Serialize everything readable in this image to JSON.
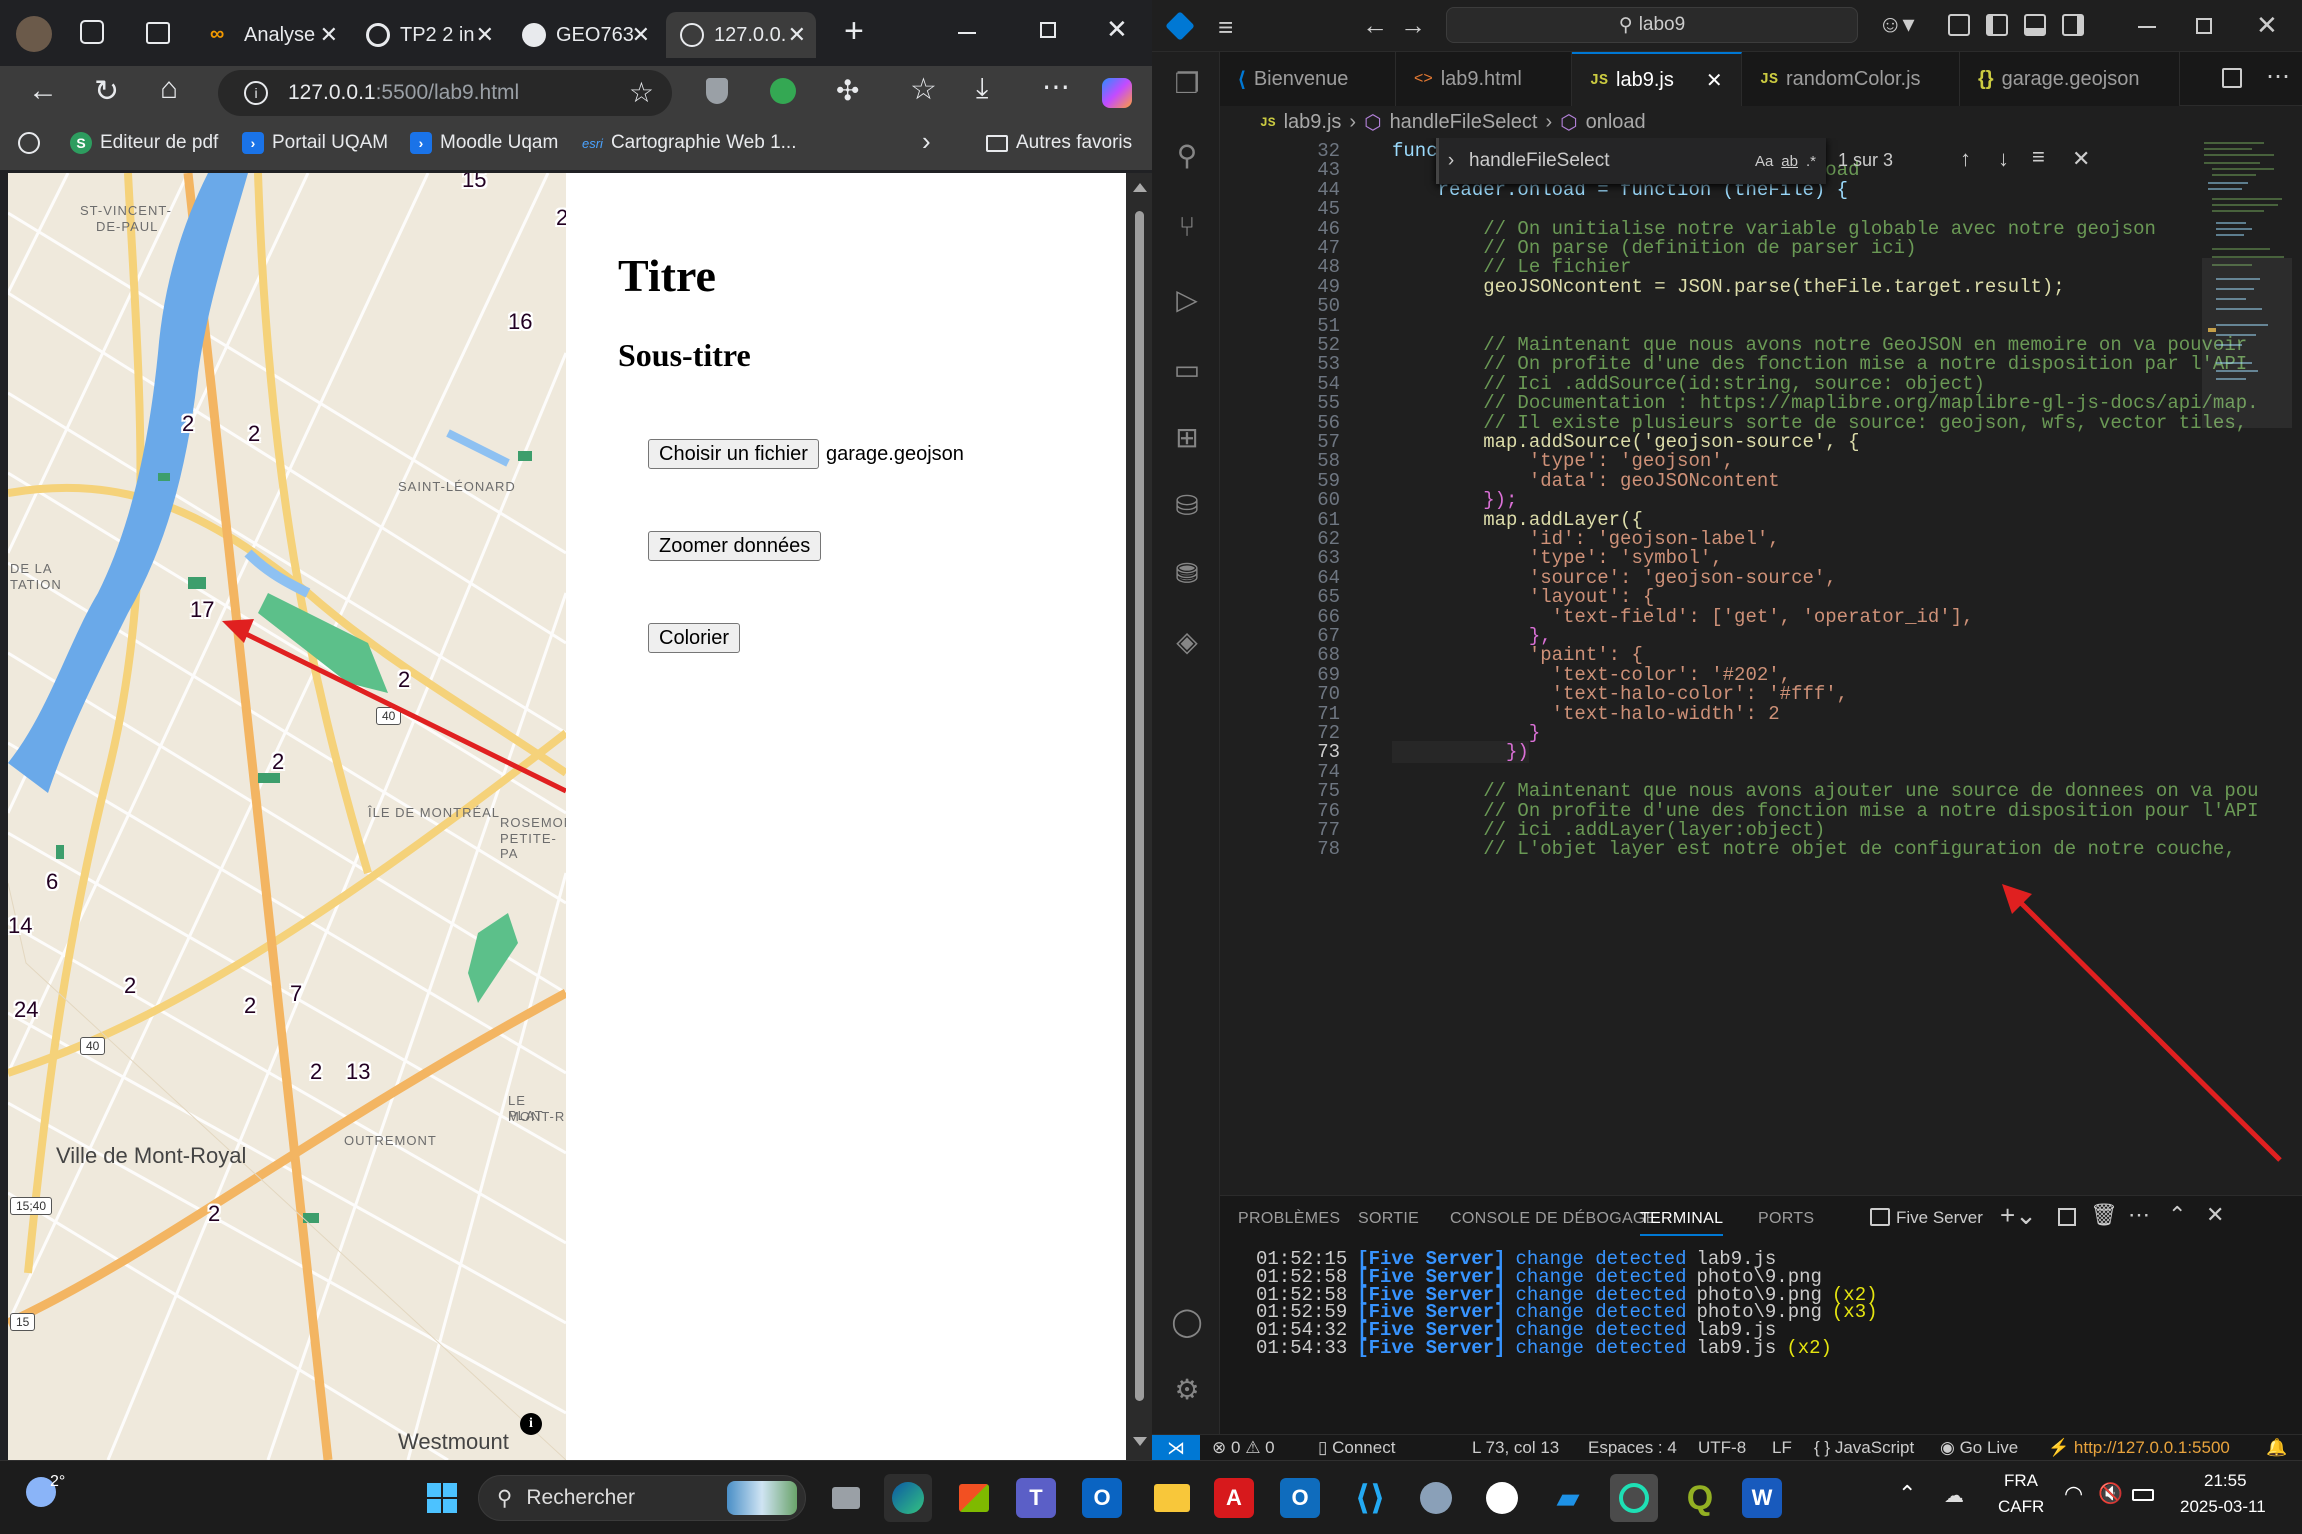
{
  "browser": {
    "tabs": [
      {
        "label": "Analyse",
        "color": "#f29900"
      },
      {
        "label": "TP2 2 in",
        "color": "#e8eaed"
      },
      {
        "label": "GEO763",
        "color": "#e8eaed"
      },
      {
        "label": "127.0.0.",
        "color": "#e8eaed"
      }
    ],
    "new_tab": "+",
    "url_host": "127.0.0.1",
    "url_rest": ":5500/lab9.html",
    "bookmarks": [
      {
        "label": "Editeur de pdf",
        "icon": "S",
        "color": "#2d9d5f"
      },
      {
        "label": "Portail UQAM",
        "icon": "›",
        "color": "#1a73e8"
      },
      {
        "label": "Moodle Uqam",
        "icon": "›",
        "color": "#1a73e8"
      },
      {
        "label": "Cartographie Web 1...",
        "icon": "esri",
        "color": "#1a73e8"
      }
    ],
    "other_bookmarks": "Autres favoris"
  },
  "map": {
    "labels": [
      {
        "text": "ST-VINCENT-",
        "cls": "pl"
      },
      {
        "text": "DE-PAUL",
        "cls": "pl"
      },
      {
        "text": "SAINT-LÉONARD",
        "cls": "pl"
      },
      {
        "text": "DE LA",
        "cls": "pl"
      },
      {
        "text": "TATION",
        "cls": "pl"
      },
      {
        "text": "ÎLE DE MONTRÉAL",
        "cls": "pl"
      },
      {
        "text": "ROSEMON",
        "cls": "pl"
      },
      {
        "text": "PETITE-PA",
        "cls": "pl"
      },
      {
        "text": "LE PLAT",
        "cls": "pl"
      },
      {
        "text": "MONT-R",
        "cls": "pl"
      },
      {
        "text": "OUTREMONT",
        "cls": "pl"
      },
      {
        "text": "Ville de Mont-Royal",
        "cls": "city"
      },
      {
        "text": "Westmount",
        "cls": "city"
      }
    ],
    "numbers": [
      "16",
      "2",
      "2",
      "17",
      "2",
      "2",
      "6",
      "14",
      "2",
      "2",
      "7",
      "24",
      "2",
      "13",
      "2",
      "15",
      "2"
    ],
    "shields": [
      "40",
      "40",
      "15;40",
      "15"
    ]
  },
  "page": {
    "title": "Titre",
    "subtitle": "Sous-titre",
    "file_button": "Choisir un fichier",
    "file_name": "garage.geojson",
    "zoom_button": "Zoomer données",
    "color_button": "Colorier"
  },
  "vscode": {
    "search": "labo9",
    "tabs": [
      {
        "label": "Bienvenue",
        "icon": "vs"
      },
      {
        "label": "lab9.html",
        "icon": "<>"
      },
      {
        "label": "lab9.js",
        "icon": "JS"
      },
      {
        "label": "randomColor.js",
        "icon": "JS"
      },
      {
        "label": "garage.geojson",
        "icon": "{}"
      }
    ],
    "breadcrumb": [
      "lab9.js",
      "handleFileSelect",
      "onload"
    ],
    "find": {
      "query": "handleFileSelect",
      "count": "1 sur 3",
      "aa": "Aa",
      "ab": "ab",
      "re": ".*"
    },
    "code": [
      {
        "n": "32",
        "t": "function handleFile"
      },
      {
        "n": "43",
        "t": "    // Debut de la fonction reader.onload"
      },
      {
        "n": "44",
        "t": "    reader.onload = function (theFile) {"
      },
      {
        "n": "45",
        "t": ""
      },
      {
        "n": "46",
        "t": "        // On unitialise notre variable globable avec notre geojson"
      },
      {
        "n": "47",
        "t": "        // On parse (definition de parser ici)"
      },
      {
        "n": "48",
        "t": "        // Le fichier"
      },
      {
        "n": "49",
        "t": "        geoJSONcontent = JSON.parse(theFile.target.result);"
      },
      {
        "n": "50",
        "t": ""
      },
      {
        "n": "51",
        "t": ""
      },
      {
        "n": "52",
        "t": "        // Maintenant que nous avons notre GeoJSON en memoire on va pouvoir"
      },
      {
        "n": "53",
        "t": "        // On profite d'une des fonction mise a notre disposition par l'API"
      },
      {
        "n": "54",
        "t": "        // Ici .addSource(id:string, source: object)"
      },
      {
        "n": "55",
        "t": "        // Documentation : https://maplibre.org/maplibre-gl-js-docs/api/map."
      },
      {
        "n": "56",
        "t": "        // Il existe plusieurs sorte de source: geojson, wfs, vector tiles,"
      },
      {
        "n": "57",
        "t": "        map.addSource('geojson-source', {"
      },
      {
        "n": "58",
        "t": "            'type': 'geojson',"
      },
      {
        "n": "59",
        "t": "            'data': geoJSONcontent"
      },
      {
        "n": "60",
        "t": "        });"
      },
      {
        "n": "61",
        "t": "        map.addLayer({"
      },
      {
        "n": "62",
        "t": "            'id': 'geojson-label',"
      },
      {
        "n": "63",
        "t": "            'type': 'symbol',"
      },
      {
        "n": "64",
        "t": "            'source': 'geojson-source',"
      },
      {
        "n": "65",
        "t": "            'layout': {"
      },
      {
        "n": "66",
        "t": "              'text-field': ['get', 'operator_id'],"
      },
      {
        "n": "67",
        "t": "            },"
      },
      {
        "n": "68",
        "t": "            'paint': {"
      },
      {
        "n": "69",
        "t": "              'text-color': '#202',"
      },
      {
        "n": "70",
        "t": "              'text-halo-color': '#fff',"
      },
      {
        "n": "71",
        "t": "              'text-halo-width': 2"
      },
      {
        "n": "72",
        "t": "            }"
      },
      {
        "n": "73",
        "t": "          })"
      },
      {
        "n": "74",
        "t": ""
      },
      {
        "n": "75",
        "t": "        // Maintenant que nous avons ajouter une source de donnees on va pou"
      },
      {
        "n": "76",
        "t": "        // On profite d'une des fonction mise a notre disposition pour l'API"
      },
      {
        "n": "77",
        "t": "        // ici .addLayer(layer:object)"
      },
      {
        "n": "78",
        "t": "        // L'objet layer est notre objet de configuration de notre couche,"
      }
    ],
    "panel_tabs": [
      "PROBLÈMES",
      "SORTIE",
      "CONSOLE DE DÉBOGAGE",
      "TERMINAL",
      "PORTS"
    ],
    "panel_server": "Five Server",
    "terminal": [
      {
        "time": "01:52:15",
        "tag": "[Five Server]",
        "msg": "change detected",
        "file": "lab9.js",
        "count": ""
      },
      {
        "time": "01:52:58",
        "tag": "[Five Server]",
        "msg": "change detected",
        "file": "photo\\9.png",
        "count": ""
      },
      {
        "time": "01:52:58",
        "tag": "[Five Server]",
        "msg": "change detected",
        "file": "photo\\9.png",
        "count": "(x2)"
      },
      {
        "time": "01:52:59",
        "tag": "[Five Server]",
        "msg": "change detected",
        "file": "photo\\9.png",
        "count": "(x3)"
      },
      {
        "time": "01:54:32",
        "tag": "[Five Server]",
        "msg": "change detected",
        "file": "lab9.js",
        "count": ""
      },
      {
        "time": "01:54:33",
        "tag": "[Five Server]",
        "msg": "change detected",
        "file": "lab9.js",
        "count": "(x2)"
      }
    ],
    "status": {
      "errors": "0",
      "warnings": "0",
      "connect": "Connect",
      "position": "L 73, col 13",
      "spaces": "Espaces : 4",
      "encoding": "UTF-8",
      "eol": "LF",
      "language": "JavaScript",
      "golive": "Go Live",
      "server_url": "http://127.0.0.1:5500"
    }
  },
  "taskbar": {
    "weather": "2°",
    "search": "Rechercher",
    "lang1": "FRA",
    "lang2": "CAFR",
    "time": "21:55",
    "date": "2025-03-11"
  }
}
